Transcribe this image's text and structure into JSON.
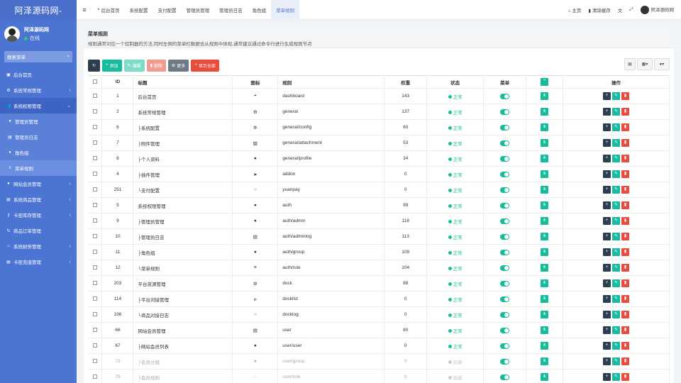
{
  "app": {
    "logo": "阿泽源码网-"
  },
  "user": {
    "name": "阿泽源码网",
    "status": "在线"
  },
  "sidebar": {
    "search_placeholder": "搜索菜单",
    "items": [
      {
        "label": "后台首页",
        "icon": "dashboard-icon",
        "glyph": "▣"
      },
      {
        "label": "系统常规管理",
        "icon": "cogs-icon",
        "glyph": "⚙",
        "caret": "‹"
      },
      {
        "label": "系统权限管理",
        "icon": "group-icon",
        "glyph": "👥",
        "caret": "⌄"
      },
      {
        "label": "管理员管理",
        "icon": "user-icon",
        "glyph": "●"
      },
      {
        "label": "管理员日志",
        "icon": "list-icon",
        "glyph": "▤"
      },
      {
        "label": "角色组",
        "icon": "group-icon",
        "glyph": "●"
      },
      {
        "label": "菜单规则",
        "icon": "bars-icon",
        "glyph": "≡"
      },
      {
        "label": "网站会员管理",
        "icon": "users-icon",
        "glyph": "●",
        "caret": "‹"
      },
      {
        "label": "系统商品管理",
        "icon": "list-icon",
        "glyph": "▤",
        "caret": "‹"
      },
      {
        "label": "卡密库存管理",
        "icon": "key-icon",
        "glyph": "⚷",
        "caret": "‹"
      },
      {
        "label": "商品订单管理",
        "icon": "refresh-icon",
        "glyph": "↻"
      },
      {
        "label": "系统财务管理",
        "icon": "bank-icon",
        "glyph": "⌂",
        "caret": "‹"
      },
      {
        "label": "卡密充值管理",
        "icon": "list-icon",
        "glyph": "▤",
        "caret": "‹"
      }
    ]
  },
  "topbar": {
    "menu_glyph": "≡",
    "tabs": [
      "后台首页",
      "系统配置",
      "支付配置",
      "管理员管理",
      "管理员日志",
      "角色组",
      "菜单规则"
    ],
    "home_label": "主页",
    "clear_cache_label": "清除缓存",
    "user_label": "阿泽源码网"
  },
  "panel": {
    "title": "菜单规则",
    "description": "规则通常对应一个控制器的方法,同时左侧的菜单栏数据也从规则中体现,通常建议通过命令行进行生成规则节点"
  },
  "toolbar": {
    "refresh_glyph": "↻",
    "add_label": "添加",
    "edit_label": "编辑",
    "delete_label": "删除",
    "more_label": "更多",
    "expand_label": "显示全部"
  },
  "table": {
    "headers": {
      "id": "ID",
      "title": "标题",
      "icon": "图标",
      "rule": "规则",
      "weigh": "权重",
      "status": "状态",
      "menu": "菜单",
      "ops": "操作"
    },
    "rows": [
      {
        "id": "1",
        "title": "后台首页",
        "glyph": "◓",
        "rule": "dashboard",
        "weigh": "143",
        "status": "正常",
        "on": true
      },
      {
        "id": "2",
        "title": "系统常规管理",
        "glyph": "⚙",
        "rule": "general",
        "weigh": "137",
        "status": "正常",
        "on": true
      },
      {
        "id": "6",
        "title": "├系统配置",
        "glyph": "✲",
        "rule": "general/config",
        "weigh": "60",
        "status": "正常",
        "on": true
      },
      {
        "id": "7",
        "title": "├附件管理",
        "glyph": "▧",
        "rule": "general/attachment",
        "weigh": "53",
        "status": "正常",
        "on": true
      },
      {
        "id": "8",
        "title": "├个人资料",
        "glyph": "●",
        "rule": "general/profile",
        "weigh": "34",
        "status": "正常",
        "on": true
      },
      {
        "id": "4",
        "title": "├插件管理",
        "glyph": "➤",
        "rule": "addon",
        "weigh": "0",
        "status": "正常",
        "on": true
      },
      {
        "id": "251",
        "title": "└支付配置",
        "glyph": "○",
        "rule": "yuanpay",
        "weigh": "0",
        "status": "正常",
        "on": true
      },
      {
        "id": "5",
        "title": "系统权限管理",
        "glyph": "●",
        "rule": "auth",
        "weigh": "99",
        "status": "正常",
        "on": true
      },
      {
        "id": "9",
        "title": "├管理员管理",
        "glyph": "●",
        "rule": "auth/admin",
        "weigh": "118",
        "status": "正常",
        "on": true
      },
      {
        "id": "10",
        "title": "├管理员日志",
        "glyph": "▤",
        "rule": "auth/adminlog",
        "weigh": "113",
        "status": "正常",
        "on": true
      },
      {
        "id": "11",
        "title": "├角色组",
        "glyph": "●",
        "rule": "auth/group",
        "weigh": "109",
        "status": "正常",
        "on": true
      },
      {
        "id": "12",
        "title": "└菜单规则",
        "glyph": "≡",
        "rule": "auth/rule",
        "weigh": "104",
        "status": "正常",
        "on": true
      },
      {
        "id": "203",
        "title": "平台资源管理",
        "glyph": "⚙",
        "rule": "dock",
        "weigh": "88",
        "status": "正常",
        "on": true
      },
      {
        "id": "114",
        "title": "├平台对接管理",
        "glyph": "ℯ",
        "rule": "docklist",
        "weigh": "0",
        "status": "正常",
        "on": true
      },
      {
        "id": "196",
        "title": "└商品对接日志",
        "glyph": "○",
        "rule": "docklog",
        "weigh": "0",
        "status": "正常",
        "on": true
      },
      {
        "id": "66",
        "title": "网站会员管理",
        "glyph": "▤",
        "rule": "user",
        "weigh": "80",
        "status": "正常",
        "on": true
      },
      {
        "id": "67",
        "title": "├网站会员列表",
        "glyph": "●",
        "rule": "user/user",
        "weigh": "0",
        "status": "正常",
        "on": true
      },
      {
        "id": "73",
        "title": "├会员分组",
        "glyph": "●",
        "rule": "user/group",
        "weigh": "0",
        "status": "隐藏",
        "on": false
      },
      {
        "id": "79",
        "title": "├会员规则",
        "glyph": "○",
        "rule": "user/rule",
        "weigh": "0",
        "status": "隐藏",
        "on": false
      }
    ]
  }
}
